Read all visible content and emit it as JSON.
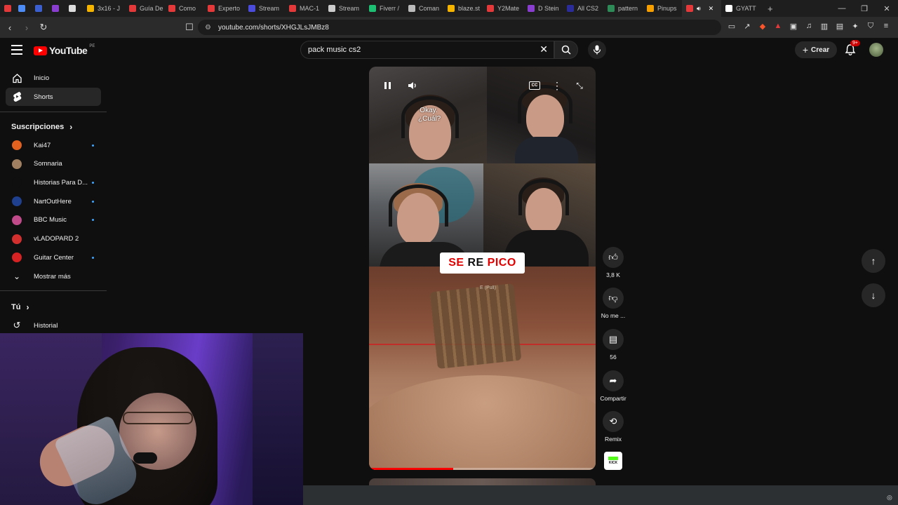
{
  "browser": {
    "tabs": [
      {
        "label": "",
        "color": "#e3393a"
      },
      {
        "label": "",
        "color": "#4e8cf5"
      },
      {
        "label": "",
        "color": "#3c5fcf"
      },
      {
        "label": "",
        "color": "#8a3ecf"
      },
      {
        "label": "",
        "color": "#dddddd"
      },
      {
        "label": "3x16 - J",
        "color": "#f5b400"
      },
      {
        "label": "Guía De",
        "color": "#e3393a"
      },
      {
        "label": "Como",
        "color": "#e3393a"
      },
      {
        "label": "Experto",
        "color": "#e3393a"
      },
      {
        "label": "Stream",
        "color": "#4b4bdc"
      },
      {
        "label": "MAC-1",
        "color": "#e3393a"
      },
      {
        "label": "Stream",
        "color": "#cccccc"
      },
      {
        "label": "Fiverr /",
        "color": "#1dbf73"
      },
      {
        "label": "Coman",
        "color": "#bbbbbb"
      },
      {
        "label": "blaze.st",
        "color": "#f5b400"
      },
      {
        "label": "Y2Mate",
        "color": "#e3393a"
      },
      {
        "label": "D Stein",
        "color": "#8a3ecf"
      },
      {
        "label": "All CS2",
        "color": "#2b2b9a"
      },
      {
        "label": "pattern",
        "color": "#2e8b57"
      },
      {
        "label": "Pinups",
        "color": "#f5a000"
      },
      {
        "label": "",
        "color": "#e3393a",
        "active": true
      },
      {
        "label": "GYATT",
        "color": "#ffffff"
      }
    ],
    "new_tab": "+",
    "url": "youtube.com/shorts/XHGJLsJMBz8"
  },
  "header": {
    "logo_text": "YouTube",
    "logo_region": "PE",
    "search_value": "pack music cs2",
    "create_label": "Crear",
    "notif_badge": "9+"
  },
  "sidebar": {
    "main": [
      {
        "label": "Inicio",
        "icon": "home-icon"
      },
      {
        "label": "Shorts",
        "icon": "shorts-icon",
        "active": true
      }
    ],
    "subs_title": "Suscripciones",
    "subscriptions": [
      {
        "label": "Kai47",
        "color": "#e2611e",
        "dot": true
      },
      {
        "label": "Somnaria",
        "color": "#a08060",
        "dot": false
      },
      {
        "label": "Historias Para D...",
        "color": "#0f0f0f",
        "dot": true
      },
      {
        "label": "NartOutHere",
        "color": "#1f3f8f",
        "dot": true
      },
      {
        "label": "BBC Music",
        "color": "#c04a8a",
        "dot": true
      },
      {
        "label": "vLADOPARD 2",
        "color": "#d32f2f",
        "dot": false
      },
      {
        "label": "Guitar Center",
        "color": "#d62222",
        "dot": true
      }
    ],
    "show_more": "Mostrar más",
    "you_title": "Tú",
    "history_label": "Historial"
  },
  "short": {
    "subtitle_line1": "Okay.",
    "subtitle_line2": "¿Cuál?",
    "overlay_word1": "SE",
    "overlay_word2": "RE",
    "overlay_word3": "PICO",
    "game_text": "E (Pull)",
    "progress": 0.37
  },
  "actions": {
    "likes": "3,8 K",
    "dislike_label": "No me ...",
    "comments": "56",
    "share_label": "Compartir",
    "remix_label": "Remix",
    "sound_label": "KICK"
  }
}
